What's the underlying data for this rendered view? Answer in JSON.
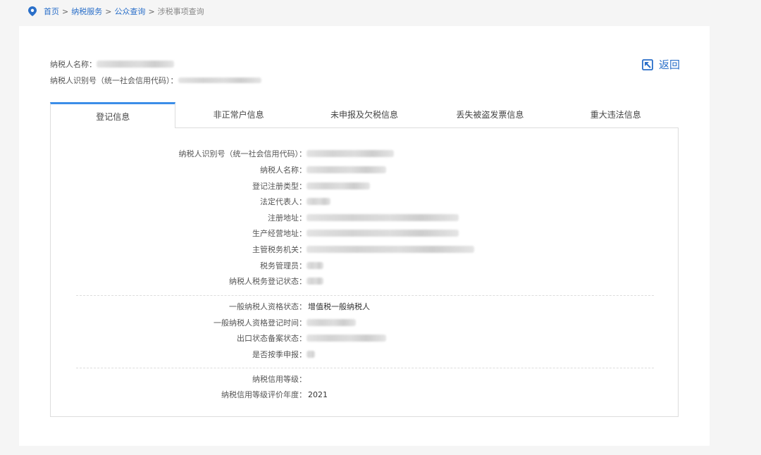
{
  "breadcrumb": {
    "home": "首页",
    "sep": ">",
    "level2": "纳税服务",
    "level3": "公众查询",
    "current": "涉税事项查询"
  },
  "taxpayer": {
    "name_label": "纳税人名称：",
    "id_label": "纳税人识别号（统一社会信用代码）："
  },
  "back_label": "返回",
  "tabs": [
    {
      "label": "登记信息",
      "active": true
    },
    {
      "label": "非正常户信息",
      "active": false
    },
    {
      "label": "未申报及欠税信息",
      "active": false
    },
    {
      "label": "丢失被盗发票信息",
      "active": false
    },
    {
      "label": "重大违法信息",
      "active": false
    }
  ],
  "fields": {
    "taxpayer_id": {
      "label": "纳税人识别号（统一社会信用代码）："
    },
    "taxpayer_name": {
      "label": "纳税人名称："
    },
    "reg_type": {
      "label": "登记注册类型："
    },
    "legal_rep": {
      "label": "法定代表人："
    },
    "reg_address": {
      "label": "注册地址："
    },
    "biz_address": {
      "label": "生产经营地址："
    },
    "tax_authority": {
      "label": "主管税务机关："
    },
    "tax_officer": {
      "label": "税务管理员："
    },
    "reg_status": {
      "label": "纳税人税务登记状态："
    },
    "general_status": {
      "label": "一般纳税人资格状态：",
      "value": "增值税一般纳税人"
    },
    "general_time": {
      "label": "一般纳税人资格登记时间："
    },
    "export_status": {
      "label": "出口状态备案状态："
    },
    "quarterly": {
      "label": "是否按季申报："
    },
    "credit_level": {
      "label": "纳税信用等级："
    },
    "credit_year": {
      "label": "纳税信用等级评价年度：",
      "value": "2021"
    }
  },
  "colors": {
    "accent": "#3b8ee8",
    "link": "#2a6fc9"
  }
}
